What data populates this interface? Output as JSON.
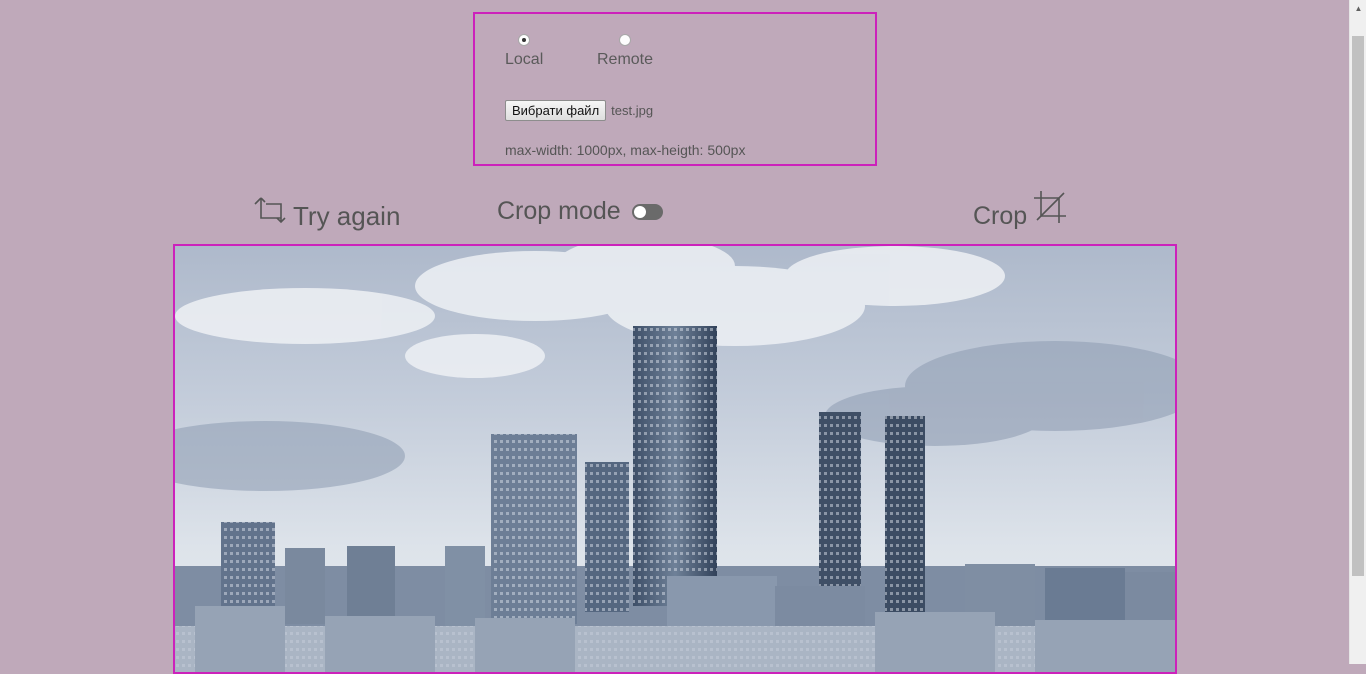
{
  "source": {
    "options": [
      {
        "label": "Local",
        "checked": true
      },
      {
        "label": "Remote",
        "checked": false
      }
    ]
  },
  "file": {
    "button_label": "Вибрати файл",
    "file_name": "test.jpg",
    "hint": "max-width: 1000px, max-heigth: 500px"
  },
  "toolbar": {
    "try_again_label": "Try again",
    "crop_mode_label": "Crop mode",
    "crop_mode_enabled": false,
    "crop_label": "Crop"
  },
  "icons": {
    "try_again": "crop-rotate-icon",
    "crop": "crop-icon",
    "scroll_up": "arrow-up-icon"
  },
  "colors": {
    "background": "#bfa9ba",
    "frame_border": "#cc22bb",
    "text": "#555555"
  }
}
